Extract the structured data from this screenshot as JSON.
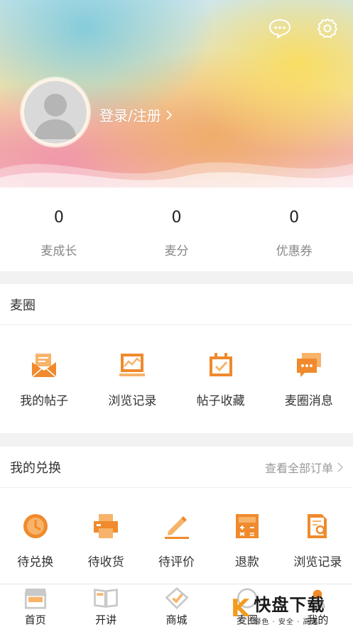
{
  "header": {
    "login_label": "登录/注册",
    "icons": [
      "message-icon",
      "settings-icon"
    ]
  },
  "stats": [
    {
      "value": "0",
      "label": "麦成长"
    },
    {
      "value": "0",
      "label": "麦分"
    },
    {
      "value": "0",
      "label": "优惠券"
    }
  ],
  "circle": {
    "title": "麦圈",
    "items": [
      {
        "label": "我的帖子",
        "icon": "post-mail-icon"
      },
      {
        "label": "浏览记录",
        "icon": "browse-history-icon"
      },
      {
        "label": "帖子收藏",
        "icon": "favorite-post-icon"
      },
      {
        "label": "麦圈消息",
        "icon": "message-bubble-icon"
      }
    ]
  },
  "exchange": {
    "title": "我的兑换",
    "view_all": "查看全部订单",
    "items": [
      {
        "label": "待兑换",
        "icon": "clock-icon"
      },
      {
        "label": "待收货",
        "icon": "printer-icon"
      },
      {
        "label": "待评价",
        "icon": "pen-icon"
      },
      {
        "label": "退款",
        "icon": "calculator-icon"
      },
      {
        "label": "浏览记录",
        "icon": "document-search-icon"
      }
    ]
  },
  "tabbar": [
    {
      "label": "首页",
      "icon": "shop-icon"
    },
    {
      "label": "开讲",
      "icon": "book-icon"
    },
    {
      "label": "商城",
      "icon": "tag-icon"
    },
    {
      "label": "麦圈",
      "icon": "circle-icon"
    },
    {
      "label": "我的",
      "icon": "user-icon"
    }
  ],
  "watermark": {
    "brand_char": "K",
    "big": "快盘下载",
    "small": "绿色 · 安全 · 高速"
  },
  "colors": {
    "accent": "#f08a2c",
    "accent_light": "#f7b36a",
    "tab_icon": "#c9c9c9"
  }
}
